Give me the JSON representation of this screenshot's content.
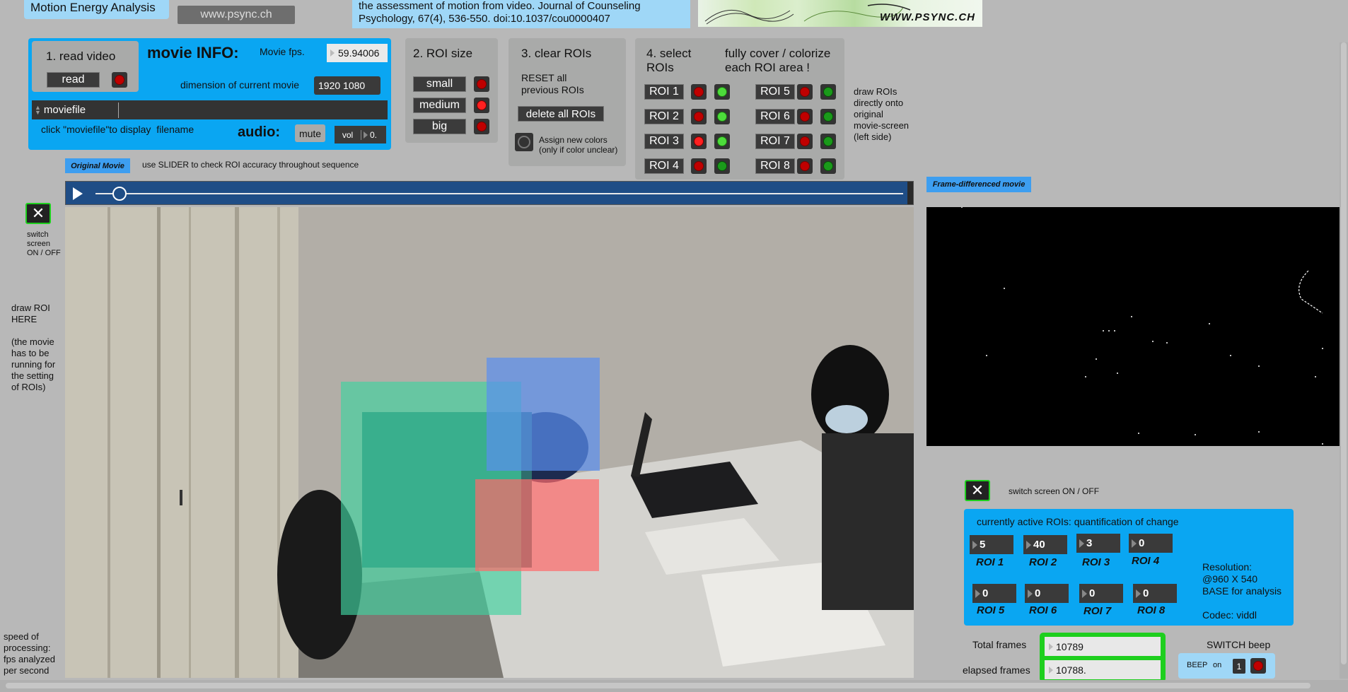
{
  "header": {
    "title": "Motion Energy Analysis",
    "link": "www.psync.ch",
    "citation_line1": "the assessment of motion from video. Journal of Counseling",
    "citation_line2": "Psychology, 67(4), 536-550. doi:10.1037/cou0000407",
    "banner_text": "WWW.PSYNC.CH"
  },
  "movie_info": {
    "step1_label": "1. read video",
    "read_button": "read",
    "title": "movie INFO:",
    "fps_label": "Movie fps.",
    "fps_value": "59.94006",
    "dimension_label": "dimension of current movie",
    "dimension_value": "1920 1080",
    "moviefile_label": "moviefile",
    "hint": "click \"moviefile\"to display  filename",
    "audio_label": "audio:",
    "mute_button": "mute",
    "vol_label": "vol",
    "vol_value": "0."
  },
  "roi_size": {
    "title": "2. ROI size",
    "small": "small",
    "medium": "medium",
    "big": "big"
  },
  "clear_rois": {
    "title": "3. clear ROIs",
    "reset_line1": "RESET all",
    "reset_line2": "previous ROIs",
    "delete_button": "delete all ROIs",
    "assign_line1": "Assign new colors",
    "assign_line2": "(only if color unclear)"
  },
  "select_rois": {
    "title_line1": "4. select",
    "title_line2": "ROIs",
    "cover_line1": "fully cover / colorize",
    "cover_line2": "each ROI area !",
    "rois": [
      "ROI 1",
      "ROI 2",
      "ROI 3",
      "ROI 4",
      "ROI 5",
      "ROI 6",
      "ROI 7",
      "ROI 8"
    ],
    "draw_note_1": "draw ROIs",
    "draw_note_2": "directly onto",
    "draw_note_3": "original",
    "draw_note_4": "movie-screen",
    "draw_note_5": "(left side)"
  },
  "original_movie": {
    "tag": "Original Movie",
    "slider_hint": "use SLIDER to check ROI accuracy throughout sequence",
    "slider_fraction": 0.03
  },
  "left_notes": {
    "switch_1": "switch",
    "switch_2": "screen",
    "switch_3": "ON / OFF",
    "draw_1": "draw ROI",
    "draw_2": "HERE",
    "draw_3": "(the movie",
    "draw_4": "has to be",
    "draw_5": "running for",
    "draw_6": "the setting",
    "draw_7": "of ROIs)",
    "speed_1": "speed of",
    "speed_2": "processing:",
    "speed_3": "fps analyzed",
    "speed_4": "per second"
  },
  "frame_diff": {
    "tag": "Frame-differenced movie",
    "switch_label": "switch screen ON / OFF"
  },
  "quantification": {
    "title": "currently active ROIs: quantification of change",
    "values": [
      {
        "name": "ROI 1",
        "value": "5"
      },
      {
        "name": "ROI 2",
        "value": "40"
      },
      {
        "name": "ROI 3",
        "value": "3"
      },
      {
        "name": "ROI 4",
        "value": "0"
      },
      {
        "name": "ROI 5",
        "value": "0"
      },
      {
        "name": "ROI 6",
        "value": "0"
      },
      {
        "name": "ROI 7",
        "value": "0"
      },
      {
        "name": "ROI 8",
        "value": "0"
      }
    ],
    "resolution_1": "Resolution:",
    "resolution_2": "@960 X 540",
    "resolution_3": "BASE for analysis",
    "codec": "Codec: viddl"
  },
  "frames": {
    "total_label": "Total frames",
    "total_value": "10789",
    "elapsed_label": "elapsed frames",
    "elapsed_value": "10788."
  },
  "beep": {
    "title": "SWITCH beep",
    "beep_label": "BEEP",
    "on_label": "on",
    "value": "1"
  },
  "colors": {
    "accent_blue": "#0aa6f2",
    "panel_gray": "#a9aaa9",
    "roi_green": "#3fd3a0",
    "roi_blue": "#5a8ff0",
    "roi_red": "#ff6a6a"
  }
}
